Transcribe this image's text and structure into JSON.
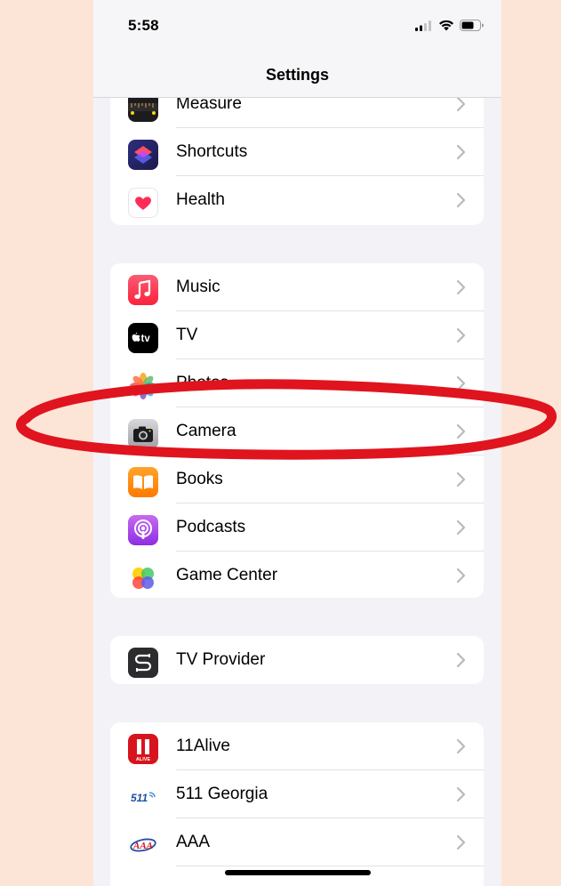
{
  "status": {
    "time": "5:58"
  },
  "header": {
    "title": "Settings"
  },
  "groups": [
    {
      "items": [
        {
          "label": "Measure"
        },
        {
          "label": "Shortcuts"
        },
        {
          "label": "Health"
        }
      ]
    },
    {
      "items": [
        {
          "label": "Music"
        },
        {
          "label": "TV"
        },
        {
          "label": "Photos"
        },
        {
          "label": "Camera"
        },
        {
          "label": "Books"
        },
        {
          "label": "Podcasts"
        },
        {
          "label": "Game Center"
        }
      ]
    },
    {
      "items": [
        {
          "label": "TV Provider"
        }
      ]
    },
    {
      "items": [
        {
          "label": "11Alive"
        },
        {
          "label": "511 Georgia"
        },
        {
          "label": "AAA"
        }
      ]
    }
  ],
  "icons": {
    "tv_text": "tv",
    "alive_text": "ALIVE",
    "ga511_text": "511",
    "aaa_text": "AAA"
  },
  "colors": {
    "page_background": "#FCE5D7",
    "highlight_ellipse": "#E0141E",
    "chevron": "#B9B9BE"
  }
}
